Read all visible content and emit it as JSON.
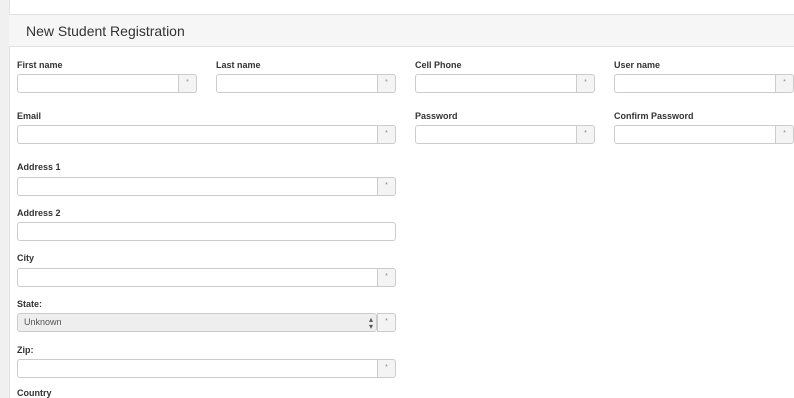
{
  "panel": {
    "title": "New Student Registration"
  },
  "form": {
    "first_name": {
      "label": "First name",
      "value": "",
      "required_marker": "*"
    },
    "last_name": {
      "label": "Last name",
      "value": "",
      "required_marker": "*"
    },
    "cell_phone": {
      "label": "Cell Phone",
      "value": "",
      "required_marker": "*"
    },
    "user_name": {
      "label": "User name",
      "value": "",
      "required_marker": "*"
    },
    "email": {
      "label": "Email",
      "value": "",
      "required_marker": "*"
    },
    "password": {
      "label": "Password",
      "value": "",
      "required_marker": "*"
    },
    "confirm_password": {
      "label": "Confirm Password",
      "value": "",
      "required_marker": "*"
    },
    "address1": {
      "label": "Address 1",
      "value": "",
      "required_marker": "*"
    },
    "address2": {
      "label": "Address 2",
      "value": ""
    },
    "city": {
      "label": "City",
      "value": "",
      "required_marker": "*"
    },
    "state": {
      "label": "State:",
      "selected": "Unknown",
      "required_marker": "*"
    },
    "zip": {
      "label": "Zip:",
      "value": "",
      "required_marker": "*"
    },
    "country": {
      "label": "Country"
    }
  },
  "icons": {
    "select_caret": "select-caret-icon",
    "required": "asterisk-icon"
  }
}
